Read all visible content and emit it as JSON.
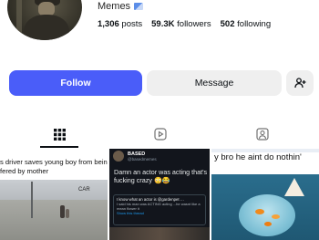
{
  "profile": {
    "name": "Memes",
    "stats": [
      {
        "value": "1,306",
        "label": "posts"
      },
      {
        "value": "59.3K",
        "label": "followers"
      },
      {
        "value": "502",
        "label": "following"
      }
    ]
  },
  "actions": {
    "follow_label": "Follow",
    "message_label": "Message"
  },
  "icons": {
    "verified": "flag-icon",
    "suggest": "add-person-icon",
    "tab_posts": "grid-icon",
    "tab_reels": "reels-icon",
    "tab_tagged": "tagged-icon"
  },
  "colors": {
    "follow_bg": "#4a5df9",
    "secondary_bg": "#efefef"
  },
  "posts": [
    {
      "caption_line1": "s driver saves young boy from being",
      "caption_line2": "fered by mother",
      "badge": "CAR"
    },
    {
      "user": "BASED",
      "handle": "@basedmemes",
      "text": "Damn an actor was acting that's fucking crazy 😳😂",
      "quote_title": "I know what an actor is @gardenpet …",
      "quote_body": "I said his man was ACTING acting ...he wasnt like a mean flower it",
      "quote_link": "Show this thread"
    },
    {
      "caption": "y bro he aint do nothin'"
    }
  ]
}
